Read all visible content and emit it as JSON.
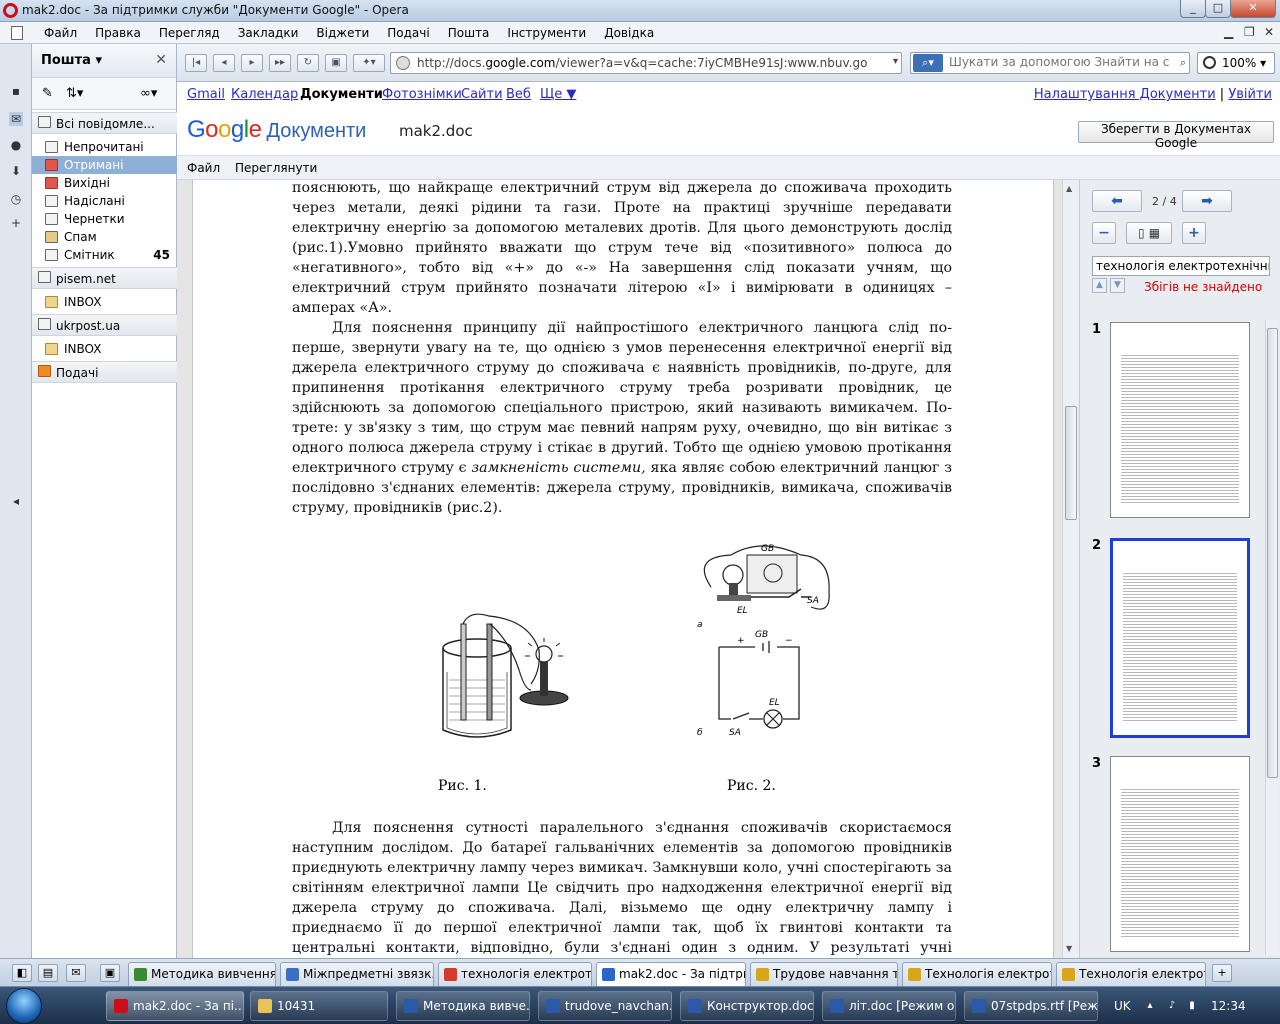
{
  "window": {
    "title": "mak2.doc - За підтримки служби \"Документи Google\" - Opera",
    "min": "_",
    "max": "□",
    "close": "✕"
  },
  "menu": [
    "Файл",
    "Правка",
    "Перегляд",
    "Закладки",
    "Віджети",
    "Подачі",
    "Пошта",
    "Інструменти",
    "Довідка"
  ],
  "mail_panel": {
    "title": "Пошта",
    "items": [
      {
        "label": "Всі повідомле...",
        "count": ""
      },
      {
        "label": "Непрочитані",
        "count": ""
      },
      {
        "label": "Отримані",
        "count": ""
      },
      {
        "label": "Вихідні",
        "count": ""
      },
      {
        "label": "Надіслані",
        "count": ""
      },
      {
        "label": "Чернетки",
        "count": ""
      },
      {
        "label": "Спам",
        "count": ""
      },
      {
        "label": "Смітник",
        "count": "45"
      }
    ],
    "accounts": [
      {
        "name": "pisem.net",
        "folder": "INBOX"
      },
      {
        "name": "ukrpost.ua",
        "folder": "INBOX"
      }
    ],
    "feeds": "Подачі"
  },
  "toolbar": {
    "url_prefix": "http://docs.",
    "url_domain": "google.com",
    "url_rest": "/viewer?a=v&q=cache:7iyCMBHe91sJ:www.nbuv.gov.ua/portal/",
    "search_placeholder": "Шукати за допомогою Знайти на сторі",
    "zoom": "100%"
  },
  "gbar": {
    "links": [
      "Gmail",
      "Календар",
      "Документи",
      "Фотознімки",
      "Сайти",
      "Веб",
      "Ще ▼"
    ],
    "settings": "Налаштування Документи",
    "sep": "|",
    "logout": "Увійти"
  },
  "docs_header": {
    "logo_google": [
      "G",
      "o",
      "o",
      "g",
      "l",
      "e"
    ],
    "logo_docs": "Документи",
    "doc_name": "mak2.doc",
    "save_button": "Зберегти в Документах Google"
  },
  "doc_menu": [
    "Файл",
    "Переглянути"
  ],
  "document": {
    "para1": "пояснюють, що найкраще електричний струм від джерела до споживача проходить через метали, деякі рідини та гази. Проте на практиці зручніше передавати електричну енергію за допомогою металевих дротів. Для цього демонструють дослід (рис.1).Умовно прийнято вважати що струм тече від «позитивного» полюса до «негативного», тобто від «+» до «-» На завершення слід показати учням, що електричний струм прийнято позначати літерою «I» і вимірювати в одиницях – амперах «А».",
    "para2a": "Для пояснення принципу дії найпростішого електричного ланцюга слід по-перше, звернути увагу на те, що однією з умов перенесення електричної енергії від джерела електричного струму до споживача є наявність провідників, по-друге, для припинення протікання електричного струму треба розривати провідник, це здійснюють за допомогою спеціального пристрою, який називають вимикачем. По-трете: у зв'язку з тим, що струм має певний напрям руху, очевидно, що він витікає з одного полюса джерела струму і стікає в другий. Тобто ще однією умовою протікання електричного струму є ",
    "para2em": "замкненість системи,",
    "para2b": " яка являє собою електричний ланцюг з послідовно з'єднаних елементів: джерела струму, провідників, вимикача, споживачів струму, провідників (рис.2).",
    "fig1_caption": "Рис. 1.",
    "fig2_caption": "Рис. 2.",
    "fig2_labels": {
      "gb": "GB",
      "el": "EL",
      "sa": "SA",
      "a": "а",
      "b": "б",
      "plus": "+",
      "minus": "−"
    },
    "para3": "Для пояснення сутності паралельного з'єднання споживачів скористаємося наступним дослідом. До батареї гальванічних елементів за допомогою провідників приєднують електричну лампу через вимикач. Замкнувши коло, учні спостерігають за світінням електричної лампи Це свідчить про надходження електричної енергії від джерела струму до споживача. Далі, візьмемо ще одну електричну лампу і приєднаємо її до першої електричної лампи так, щоб їх гвинтові контакти та центральні контакти, відповідно, були з'єднані один з одним. У результаті учні спостерігають таке ж саме"
  },
  "side_panel": {
    "page_indicator": "2 / 4",
    "search_value": "технологія електротехнічних",
    "not_found": "Збігів не знайдено",
    "thumbs": [
      "1",
      "2",
      "3"
    ]
  },
  "tabs": [
    {
      "label": "Методика вивчення ...",
      "active": false,
      "color": "#3a8a2e"
    },
    {
      "label": "Міжпредметні звязк...",
      "active": false,
      "color": "#3c6fc4"
    },
    {
      "label": "технологія електроте...",
      "active": false,
      "color": "#d23b2e"
    },
    {
      "label": "mak2.doc - За підтри...",
      "active": true,
      "color": "#2a66c8"
    },
    {
      "label": "Трудове навчання та...",
      "active": false,
      "color": "#d9a51b"
    },
    {
      "label": "Технологія електрот...",
      "active": false,
      "color": "#d9a51b"
    },
    {
      "label": "Технологія електрот...",
      "active": false,
      "color": "#d9a51b"
    }
  ],
  "tab_add": "+",
  "taskbar": {
    "buttons": [
      {
        "label": "mak2.doc - За пі...",
        "color": "#cc0f16",
        "active": true
      },
      {
        "label": "10431",
        "color": "#e8c35a",
        "active": false
      },
      {
        "label": "Методика вивче...",
        "color": "#2a5aa8",
        "active": false
      },
      {
        "label": "trudove_navchan...",
        "color": "#2a5aa8",
        "active": false
      },
      {
        "label": "Конструктор.doc...",
        "color": "#2a5aa8",
        "active": false
      },
      {
        "label": "літ.doc [Режим о...",
        "color": "#2a5aa8",
        "active": false
      },
      {
        "label": "07stpdps.rtf [Реж...",
        "color": "#2a5aa8",
        "active": false
      }
    ],
    "lang": "UK",
    "time": "12:34"
  }
}
